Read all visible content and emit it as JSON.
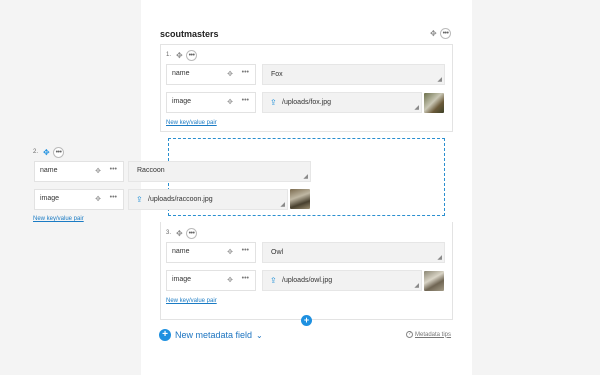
{
  "section": {
    "title": "scoutmasters"
  },
  "icons": {
    "move": "move-icon",
    "more": "more-icon",
    "upload": "upload-icon",
    "resize": "resize-handle-icon",
    "add": "plus-icon",
    "chevron": "chevron-down-icon",
    "help": "question-icon"
  },
  "items": [
    {
      "number": "1.",
      "name_key": "name",
      "name_value": "Fox",
      "image_key": "image",
      "image_value": "/uploads/fox.jpg",
      "add_pair": "New key/value pair"
    },
    {
      "number": "2.",
      "name_key": "name",
      "name_value": "Raccoon",
      "image_key": "image",
      "image_value": "/uploads/raccoon.jpg",
      "add_pair": "New key/value pair"
    },
    {
      "number": "3.",
      "name_key": "name",
      "name_value": "Owl",
      "image_key": "image",
      "image_value": "/uploads/owl.jpg",
      "add_pair": "New key/value pair"
    }
  ],
  "footer": {
    "new_field": "New metadata field",
    "tips": "Metadata tips"
  },
  "colors": {
    "accent": "#1e90e0",
    "link": "#1a7bc4",
    "drop_border": "#2a8fd0"
  }
}
